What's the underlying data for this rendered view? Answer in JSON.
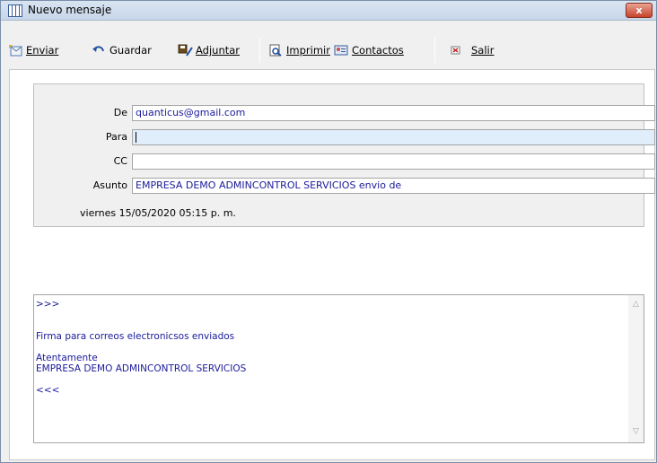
{
  "window": {
    "title": "Nuevo mensaje",
    "close_label": "x"
  },
  "toolbar": {
    "send_label": "Enviar",
    "save_label": "Guardar",
    "attach_label": "Adjuntar",
    "print_label": "Imprimir",
    "contacts_label": "Contactos",
    "exit_label": "Salir"
  },
  "header": {
    "from_label": "De",
    "from_value": "quanticus@gmail.com",
    "to_label": "Para",
    "to_value": "",
    "cc_label": "CC",
    "cc_value": "",
    "subject_label": "Asunto",
    "subject_value": "EMPRESA DEMO ADMINCONTROL SERVICIOS envio de",
    "date": "viernes 15/05/2020 05:15 p. m."
  },
  "body": {
    "lines": [
      ">>>",
      "",
      "",
      "Firma para correos electronicsos enviados",
      "",
      "Atentamente",
      "EMPRESA DEMO ADMINCONTROL SERVICIOS",
      "",
      "<<<"
    ]
  },
  "colors": {
    "field_text": "#1a1a9a",
    "title_bar": "#c7d6e9",
    "close_button": "#c7432b"
  }
}
